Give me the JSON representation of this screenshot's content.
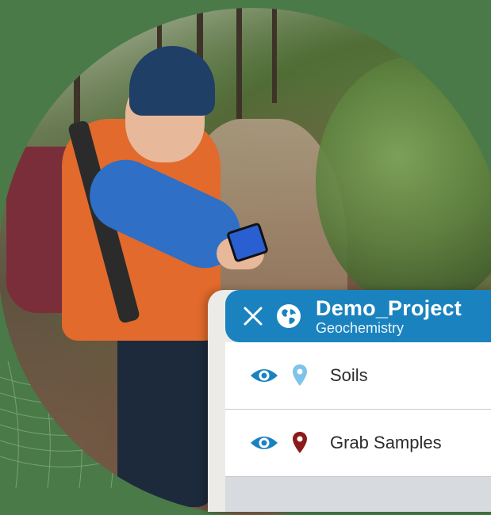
{
  "project": {
    "name": "Demo_Project",
    "subtitle": "Geochemistry"
  },
  "header_icons": {
    "close": "close-icon",
    "project": "globe-icon"
  },
  "layers": [
    {
      "label": "Soils",
      "visibility_icon": "eye-icon",
      "marker_icon": "location-pin-icon",
      "marker_color": "#7ec3ea"
    },
    {
      "label": "Grab Samples",
      "visibility_icon": "eye-icon",
      "marker_icon": "location-pin-icon",
      "marker_color": "#8b1a1a"
    }
  ],
  "colors": {
    "accent": "#1a83bf",
    "eye": "#1a83bf",
    "background": "#4a7a48"
  }
}
